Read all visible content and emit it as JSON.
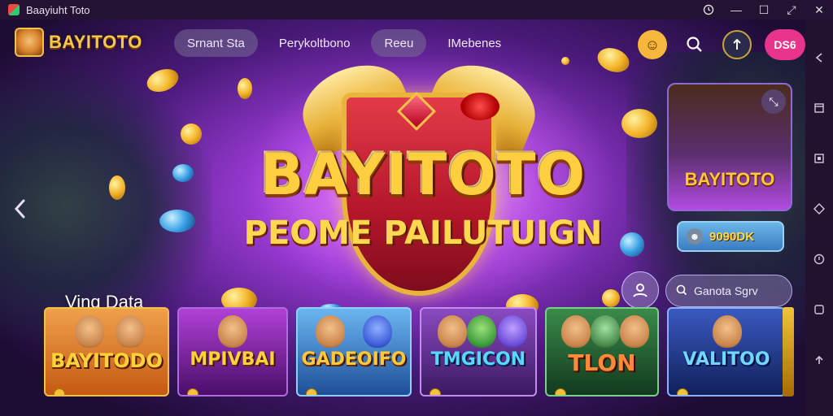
{
  "window": {
    "title": "Baayiuht Toto"
  },
  "window_controls": {
    "history_icon": "clock-icon",
    "minimize_symbol": "—",
    "maximize_symbol": "☐",
    "expand_symbol": "⤢",
    "close_symbol": "✕"
  },
  "logo": {
    "text": "BAYITOTO"
  },
  "nav": {
    "items": [
      {
        "label": "Srnant Sta",
        "style": "pill"
      },
      {
        "label": "Perykoltbono",
        "style": "plain"
      },
      {
        "label": "Reeu",
        "style": "pill"
      },
      {
        "label": "IMebenes",
        "style": "plain"
      }
    ]
  },
  "top_icons": {
    "coin_symbol": "☺",
    "search_symbol": "⚲",
    "user_symbol": "▲",
    "cta_label": "DS6"
  },
  "hero": {
    "title": "BAYITOTO",
    "subtitle": "PEOME PAILUTUIGN",
    "prev_arrow": "‹"
  },
  "promo": {
    "logo_text": "BAYITOTO",
    "close_symbol": "⤡",
    "balance_icon_symbol": "☻",
    "balance_value": "9090DK"
  },
  "support": {
    "symbol": "☻"
  },
  "search": {
    "icon_symbol": "⚲",
    "placeholder": "Ganota Sgrv"
  },
  "section": {
    "title": "Ving Data"
  },
  "games": [
    {
      "title": "BAYITODO",
      "title_color": "#ffd23a",
      "bg": "#e07a1f"
    },
    {
      "title": "MPIVBAI",
      "title_color": "#ffd23a",
      "bg": "#6a1e8a"
    },
    {
      "title": "GADEOIFO",
      "title_color": "#ffc93a",
      "bg": "#2e6fb0"
    },
    {
      "title": "TMGICON",
      "title_color": "#57d8ff",
      "bg": "#4a2a70"
    },
    {
      "title": "TLON",
      "title_color": "#ff8a3a",
      "bg": "#1f5a2e"
    },
    {
      "title": "VALITOO",
      "title_color": "#6fd8ff",
      "bg": "#1f3a7a"
    }
  ],
  "side_toolbar": {
    "items": [
      "arrow-left-icon",
      "window-icon",
      "frame-icon",
      "diamond-icon",
      "circle-icon",
      "square-icon",
      "arrow-up-icon"
    ]
  }
}
